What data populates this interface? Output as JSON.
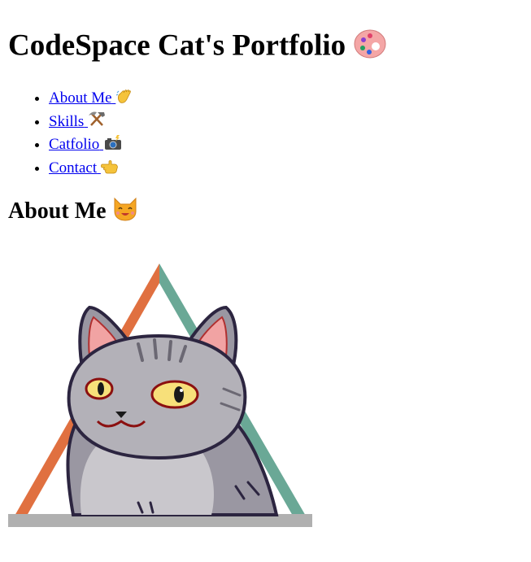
{
  "header": {
    "title": "CodeSpace Cat's Portfolio",
    "title_icon": "palette-icon"
  },
  "nav": {
    "items": [
      {
        "label": "About Me",
        "icon": "waving-hand-icon"
      },
      {
        "label": "Skills",
        "icon": "hammer-and-pick-icon"
      },
      {
        "label": "Catfolio",
        "icon": "camera-with-flash-icon"
      },
      {
        "label": "Contact",
        "icon": "backhand-index-pointing-left-icon"
      }
    ]
  },
  "about": {
    "heading": "About Me",
    "heading_icon": "smiling-cat-icon",
    "image_alt": "cat-illustration-icon"
  },
  "colors": {
    "link": "#0000ee",
    "triangle_left": "#e07040",
    "triangle_right": "#6aa896",
    "cat_fur": "#a9a6ad",
    "cat_outline": "#2c2540"
  }
}
